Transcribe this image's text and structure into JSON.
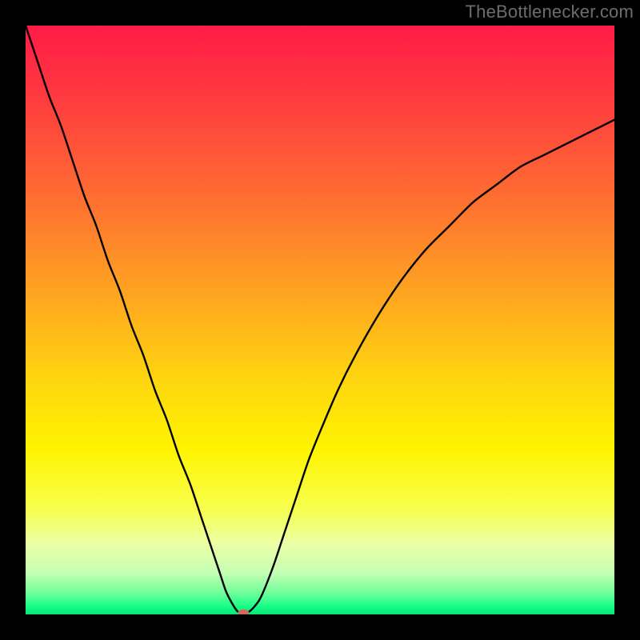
{
  "attribution": "TheBottlenecker.com",
  "chart_data": {
    "type": "line",
    "title": "",
    "xlabel": "",
    "ylabel": "",
    "xlim": [
      0,
      100
    ],
    "ylim": [
      0,
      100
    ],
    "background_gradient": {
      "stops": [
        {
          "offset": 0.0,
          "color": "#ff1b47"
        },
        {
          "offset": 0.12,
          "color": "#ff3a3f"
        },
        {
          "offset": 0.28,
          "color": "#ff6a33"
        },
        {
          "offset": 0.45,
          "color": "#ffa321"
        },
        {
          "offset": 0.6,
          "color": "#ffd50f"
        },
        {
          "offset": 0.72,
          "color": "#fff400"
        },
        {
          "offset": 0.82,
          "color": "#f6ff4d"
        },
        {
          "offset": 0.88,
          "color": "#ecffa6"
        },
        {
          "offset": 0.93,
          "color": "#c4ffb3"
        },
        {
          "offset": 0.965,
          "color": "#6cff9a"
        },
        {
          "offset": 0.985,
          "color": "#1bff89"
        },
        {
          "offset": 1.0,
          "color": "#06e676"
        }
      ]
    },
    "series": [
      {
        "name": "bottleneck-curve",
        "x": [
          0,
          2,
          4,
          6,
          8,
          10,
          12,
          14,
          16,
          18,
          20,
          22,
          24,
          26,
          28,
          30,
          32,
          33,
          34,
          35,
          36,
          37,
          38,
          39,
          40,
          42,
          44,
          46,
          48,
          50,
          53,
          56,
          60,
          64,
          68,
          72,
          76,
          80,
          84,
          88,
          92,
          96,
          100
        ],
        "y": [
          100,
          94,
          88,
          83,
          77,
          71,
          66,
          60,
          55,
          49,
          44,
          38,
          33,
          27,
          22,
          16,
          10,
          7,
          4,
          2,
          0.5,
          0.2,
          0.5,
          1.5,
          3,
          8,
          14,
          20,
          26,
          31,
          38,
          44,
          51,
          57,
          62,
          66,
          70,
          73,
          76,
          78,
          80,
          82,
          84
        ]
      }
    ],
    "marker": {
      "x": 37,
      "y": 0.3,
      "color": "#d06a5f",
      "rx": 7,
      "ry": 4
    }
  }
}
